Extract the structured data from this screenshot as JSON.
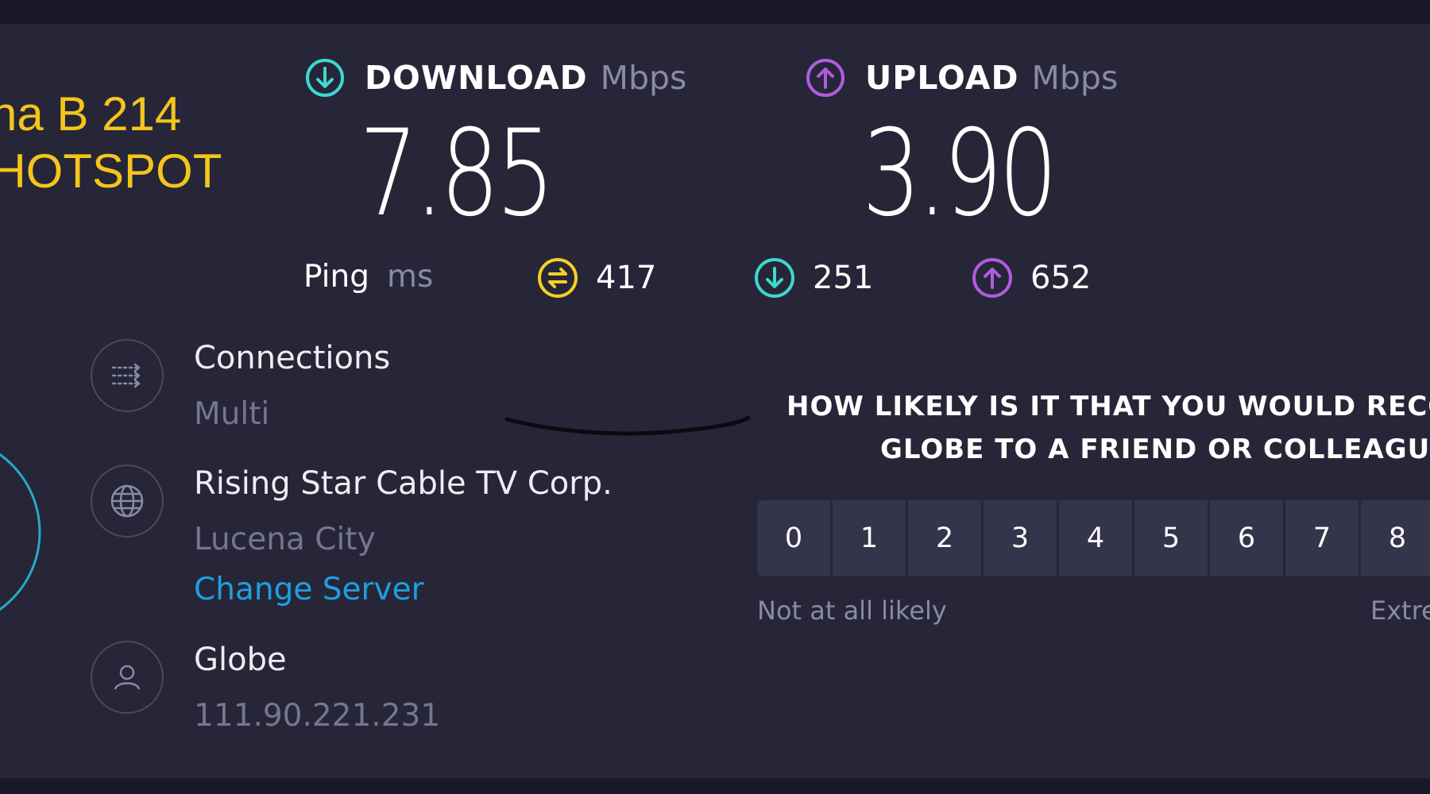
{
  "overlay": {
    "line1": "na B 214",
    "line2": "HOTSPOT",
    "color": "#f4c51a"
  },
  "download": {
    "label": "DOWNLOAD",
    "unit": "Mbps",
    "value": "7.85",
    "icon": "download-arrow-icon",
    "color": "#3dd8d0"
  },
  "upload": {
    "label": "UPLOAD",
    "unit": "Mbps",
    "value": "3.90",
    "icon": "upload-arrow-icon",
    "color": "#b05ce0"
  },
  "ping": {
    "label": "Ping",
    "unit": "ms",
    "idle": "417",
    "download": "251",
    "upload": "652",
    "idle_color": "#f5d024"
  },
  "connections": {
    "label": "Connections",
    "value": "Multi",
    "icon": "connections-icon"
  },
  "server": {
    "name": "Rising Star Cable TV Corp.",
    "location": "Lucena City",
    "change_label": "Change Server",
    "icon": "globe-icon"
  },
  "provider": {
    "name": "Globe",
    "ip": "111.90.221.231",
    "icon": "user-icon"
  },
  "survey": {
    "question_line1": "HOW LIKELY IS IT THAT YOU WOULD RECO",
    "question_line2": "GLOBE TO A FRIEND OR COLLEAGU",
    "scale": [
      "0",
      "1",
      "2",
      "3",
      "4",
      "5",
      "6",
      "7",
      "8"
    ],
    "low_label": "Not at all likely",
    "high_label": "Extre"
  },
  "colors": {
    "background": "#262638",
    "link": "#1da0e0",
    "muted": "#8a8aa2"
  }
}
